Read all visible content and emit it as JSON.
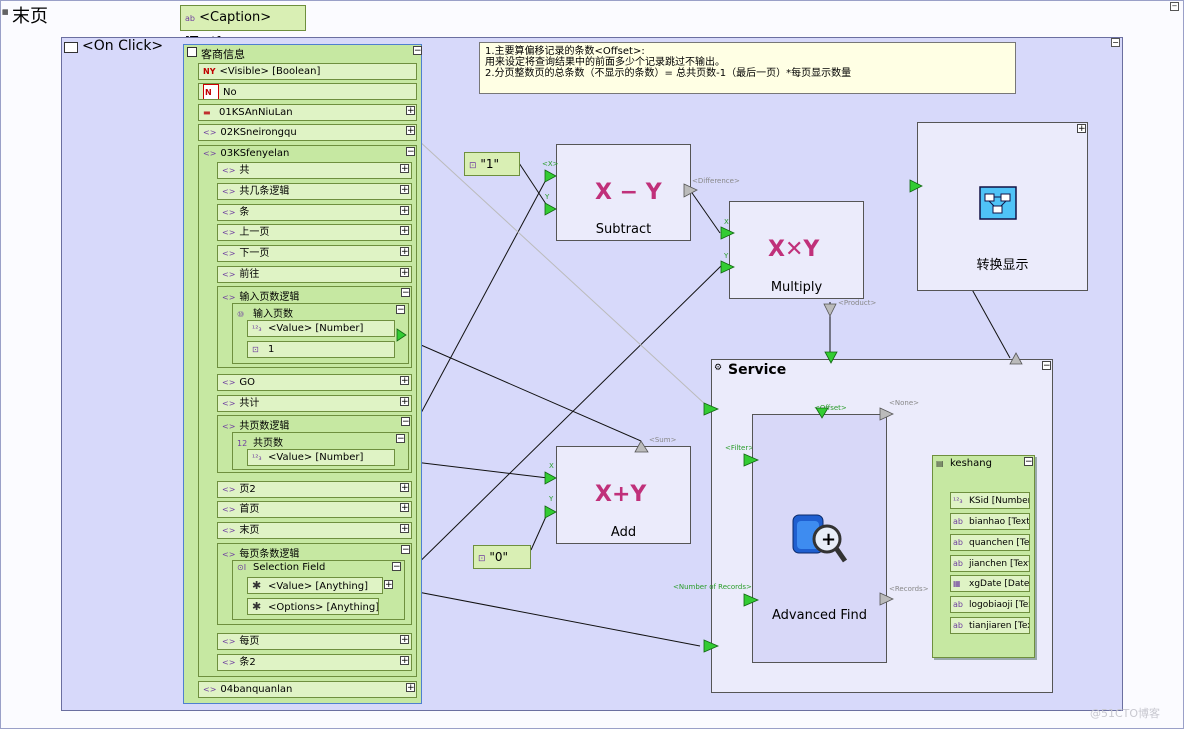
{
  "page": {
    "title": "末页",
    "caption_node": "<Caption> [Text]",
    "onclick_label": "<On Click>",
    "watermark": "@51CTO博客"
  },
  "panel": {
    "title": "客商信息",
    "visible_row": "<Visible> [Boolean]",
    "no_row": "No",
    "row_01": "01KSAnNiuLan",
    "row_02": "02KSneirongqu",
    "row_03": "03KSfenyelan",
    "sub": {
      "gong": "共",
      "gongji_logic": "共几条逻辑",
      "tiao": "条",
      "prev": "上一页",
      "next": "下一页",
      "goto": "前往",
      "input_logic": "输入页数逻辑",
      "input_pages": "输入页数",
      "input_value": "<Value> [Number]",
      "input_const": "1",
      "go": "GO",
      "total": "共计",
      "totalpages_logic": "共页数逻辑",
      "totalpages": "共页数",
      "totalpages_value": "<Value> [Number]",
      "page2": "页2",
      "first": "首页",
      "last": "末页",
      "perpage_logic": "每页条数逻辑",
      "selection_field": "Selection Field",
      "sel_value": "<Value> [Anything]",
      "sel_options": "<Options> [Anything]",
      "perpage": "每页",
      "tiao2": "条2"
    },
    "row_04": "04banquanlan"
  },
  "note": {
    "line1": "1.主要算偏移记录的条数<Offset>:",
    "line2": "用来设定将查询结果中的前面多少个记录跳过不输出。",
    "line3": "2.分页整数页的总条数（不显示的条数）= 总共页数-1（最后一页）*每页显示数量"
  },
  "nodes": {
    "subtract": {
      "symbol": "X − Y",
      "label": "Subtract",
      "port_x": "<X>",
      "port_y": "Y",
      "out": "<Difference>"
    },
    "multiply": {
      "symbol": "X✕Y",
      "label": "Multiply",
      "port_x": "X",
      "port_y": "Y",
      "out": "<Product>"
    },
    "add": {
      "symbol": "X+Y",
      "label": "Add",
      "port_x": "X",
      "port_y": "Y",
      "out": "<Sum>"
    },
    "const_one": "\"1\"",
    "const_zero": "\"0\"",
    "convert": {
      "label": "转换显示"
    }
  },
  "service": {
    "title": "Service",
    "port_filter": "<Filter>",
    "port_num_records": "<Number of Records>",
    "port_offset": "<Offset>",
    "port_none": "<None>",
    "port_records": "<Records>",
    "advanced_find": "Advanced Find",
    "keshang": {
      "title": "keshang",
      "fields": [
        "KSid [Number]",
        "bianhao [Text]",
        "quanchen [Text]",
        "jianchen [Text]",
        "xgDate [Date]",
        "logobiaoji [Text]",
        "tianjiaren [Text]"
      ]
    }
  },
  "colors": {
    "canvas": "#d7d9fa",
    "panel": "#c6e8a2",
    "port": "#33cc33",
    "operator": "#c0307a"
  }
}
